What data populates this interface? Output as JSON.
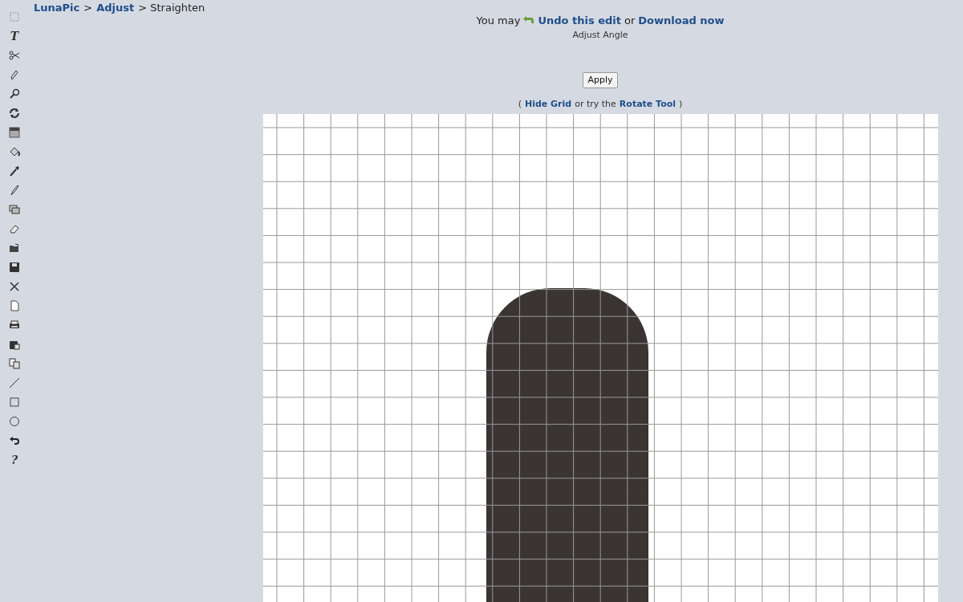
{
  "toolbar": [
    {
      "kind": "select"
    },
    {
      "kind": "glyph",
      "glyph": "T"
    },
    {
      "kind": "scissors"
    },
    {
      "kind": "pencil"
    },
    {
      "kind": "magnifier"
    },
    {
      "kind": "rotate"
    },
    {
      "kind": "gradient"
    },
    {
      "kind": "bucket"
    },
    {
      "kind": "dropper"
    },
    {
      "kind": "brush"
    },
    {
      "kind": "layers"
    },
    {
      "kind": "eraser"
    },
    {
      "kind": "folder"
    },
    {
      "kind": "save"
    },
    {
      "kind": "close"
    },
    {
      "kind": "page"
    },
    {
      "kind": "printer"
    },
    {
      "kind": "paste"
    },
    {
      "kind": "copy"
    },
    {
      "kind": "line"
    },
    {
      "kind": "rectangle"
    },
    {
      "kind": "circle"
    },
    {
      "kind": "undo"
    },
    {
      "kind": "glyph",
      "glyph": "?"
    }
  ],
  "breadcrumb": [
    {
      "label": "LunaPic",
      "link": true
    },
    {
      "label": ">",
      "link": false
    },
    {
      "label": "Adjust",
      "link": true
    },
    {
      "label": "> Straighten",
      "link": false
    }
  ],
  "notice": {
    "prefix": "You may",
    "undo_link": "Undo this edit",
    "middle": "or",
    "download_link": "Download now"
  },
  "subtitle": "Adjust Angle",
  "apply_button": "Apply",
  "grid_links": {
    "open": "(",
    "hide_link": "Hide Grid",
    "middle": "or try the",
    "rotate_link": "Rotate Tool",
    "close": ")"
  }
}
